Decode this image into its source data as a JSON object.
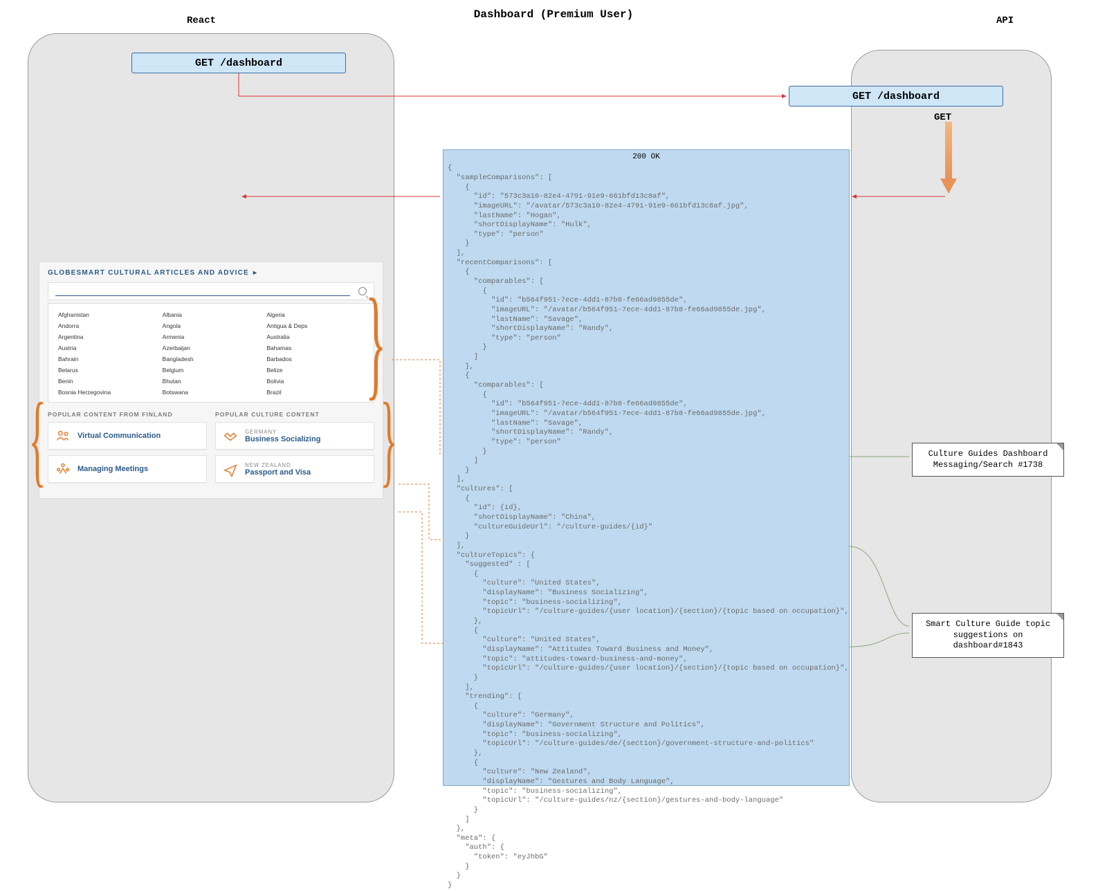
{
  "diagram": {
    "title": "Dashboard (Premium User)",
    "lanes": {
      "react": "React",
      "api": "API"
    },
    "req": {
      "react": "GET /dashboard",
      "api": "GET /dashboard"
    },
    "get_label": "GET",
    "status": "200 OK"
  },
  "notes": {
    "cultures": "Culture Guides Dashboard Messaging/Search #1738",
    "topics": "Smart Culture Guide topic suggestions on dashboard#1843"
  },
  "widget": {
    "title": "GLOBESMART CULTURAL ARTICLES AND ADVICE",
    "countries": [
      "Afghanistan",
      "Albania",
      "Algeria",
      "Andorra",
      "Angola",
      "Antigua & Deps",
      "Argentina",
      "Armenia",
      "Australia",
      "Austria",
      "Azerbaijan",
      "Bahamas",
      "Bahrain",
      "Bangladesh",
      "Barbados",
      "Belarus",
      "Belgium",
      "Belize",
      "Benin",
      "Bhutan",
      "Bolivia",
      "Bosnia Herzegovina",
      "Botswana",
      "Brazil"
    ],
    "popular_from_heading": "POPULAR CONTENT FROM FINLAND",
    "popular_culture_heading": "POPULAR CULTURE CONTENT",
    "cards_left": [
      {
        "title": "Virtual Communication"
      },
      {
        "title": "Managing Meetings"
      }
    ],
    "cards_right": [
      {
        "sub": "GERMANY",
        "title": "Business Socializing"
      },
      {
        "sub": "NEW ZEALAND",
        "title": "Passport and Visa"
      }
    ]
  },
  "payload": {
    "sampleComparisons": [
      {
        "id": "573c3a10-82e4-4791-91e9-661bfd13c8af",
        "imageURL": "/avatar/573c3a10-82e4-4791-91e9-661bfd13c8af.jpg",
        "lastName": "Hogan",
        "shortDisplayName": "Hulk",
        "type": "person"
      }
    ],
    "recentComparisons": [
      {
        "comparables": [
          {
            "id": "b564f951-7ece-4dd1-87b8-fe66ad9855de",
            "imageURL": "/avatar/b564f951-7ece-4dd1-87b8-fe66ad9855de.jpg",
            "lastName": "Savage",
            "shortDisplayName": "Randy",
            "type": "person"
          }
        ]
      },
      {
        "comparables": [
          {
            "id": "b564f951-7ece-4dd1-87b8-fe66ad9855de",
            "imageURL": "/avatar/b564f951-7ece-4dd1-87b8-fe66ad9855de.jpg",
            "lastName": "Savage",
            "shortDisplayName": "Randy",
            "type": "person"
          }
        ]
      }
    ],
    "cultures": [
      {
        "id": "{id}",
        "shortDisplayName": "China",
        "cultureGuideUrl": "/culture-guides/{id}"
      }
    ],
    "cultureTopics": {
      "suggested": [
        {
          "culture": "United States",
          "displayName": "Business Socializing",
          "topic": "business-socializing",
          "topicUrl": "/culture-guides/{user location}/{section}/{topic based on occupation}"
        },
        {
          "culture": "United States",
          "displayName": "Attitudes Toward Business and Money",
          "topic": "attitudes-toward-business-and-money",
          "topicUrl": "/culture-guides/{user location}/{section}/{topic based on occupation}"
        }
      ],
      "trending": [
        {
          "culture": "Germany",
          "displayName": "Government Structure and Politics",
          "topic": "business-socializing",
          "topicUrl": "/culture-guides/de/{section}/government-structure-and-politics"
        },
        {
          "culture": "New Zealand",
          "displayName": "Gestures and Body Language",
          "topic": "business-socializing",
          "topicUrl": "/culture-guides/nz/{section}/gestures-and-body-language"
        }
      ]
    },
    "meta": {
      "auth": {
        "token": "eyJhbG"
      }
    }
  }
}
